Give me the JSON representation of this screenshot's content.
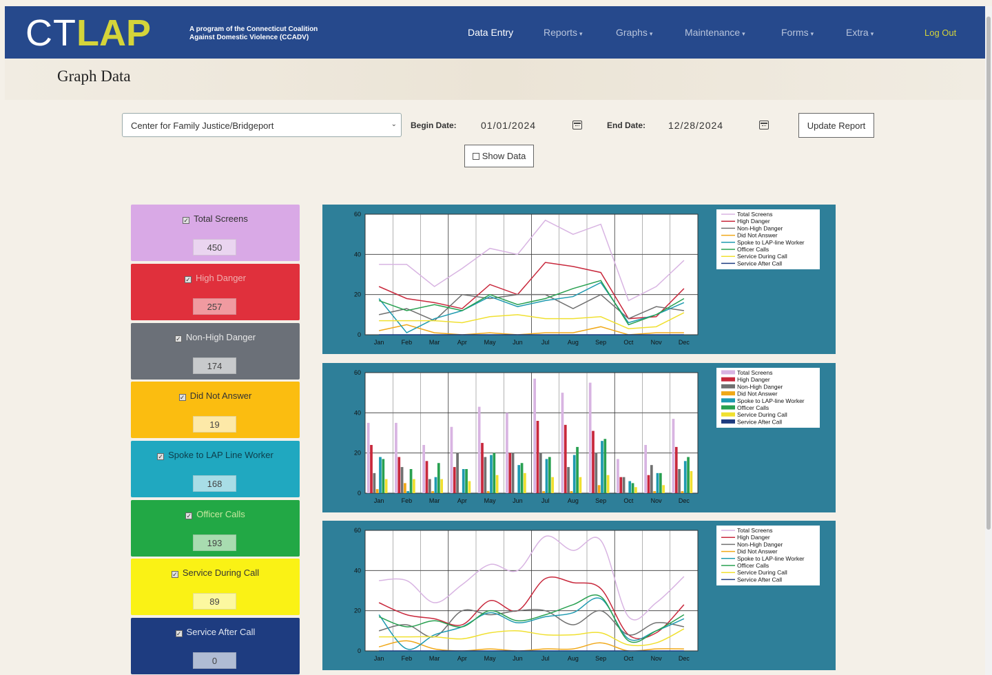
{
  "brand": {
    "ct": "CT",
    "lap": "LAP",
    "tagline_1": "A program of the Connecticut Coalition",
    "tagline_2": "Against Domestic Violence (CCADV)"
  },
  "nav": {
    "items": [
      {
        "label": "Data Entry",
        "dropdown": false,
        "active": true
      },
      {
        "label": "Reports",
        "dropdown": true
      },
      {
        "label": "Graphs",
        "dropdown": true
      },
      {
        "label": "Maintenance",
        "dropdown": true
      },
      {
        "label": "Forms",
        "dropdown": true
      },
      {
        "label": "Extra",
        "dropdown": true
      }
    ],
    "logout": "Log Out"
  },
  "page": {
    "title": "Graph Data"
  },
  "filters": {
    "agency": "Center for Family Justice/Bridgeport",
    "begin_label": "Begin Date:",
    "begin_value": "01/01/2024",
    "end_label": "End Date:",
    "end_value": "12/28/2024",
    "update_label": "Update Report",
    "show_data_label": "Show Data",
    "show_data_checked": false
  },
  "cards": [
    {
      "label": "Total Screens",
      "value": "450",
      "checked": true,
      "bg": "#d9a9e6",
      "fg": "#333",
      "valbg": "#ead5f0"
    },
    {
      "label": "High Danger",
      "value": "257",
      "checked": true,
      "bg": "#e0303c",
      "fg": "#f0b0b0",
      "valbg": "#f09aa0"
    },
    {
      "label": "Non-High Danger",
      "value": "174",
      "checked": true,
      "bg": "#6b7078",
      "fg": "#e8e8e8",
      "valbg": "#c8cacc"
    },
    {
      "label": "Did Not Answer",
      "value": "19",
      "checked": true,
      "bg": "#fbbd10",
      "fg": "#333",
      "valbg": "#fde9a8"
    },
    {
      "label": "Spoke to LAP Line Worker",
      "value": "168",
      "checked": true,
      "bg": "#20a8c0",
      "fg": "#0d3d4a",
      "valbg": "#a8dde6"
    },
    {
      "label": "Officer Calls",
      "value": "193",
      "checked": true,
      "bg": "#22a845",
      "fg": "#c8e8a0",
      "valbg": "#a8dcb0"
    },
    {
      "label": "Service During Call",
      "value": "89",
      "checked": true,
      "bg": "#faf215",
      "fg": "#333",
      "valbg": "#fcf8a0"
    },
    {
      "label": "Service After Call",
      "value": "0",
      "checked": true,
      "bg": "#1e3c80",
      "fg": "#e0e6f0",
      "valbg": "#b0bcd4"
    }
  ],
  "chart_data": [
    {
      "type": "line",
      "categories": [
        "Jan",
        "Feb",
        "Mar",
        "Apr",
        "May",
        "Jun",
        "Jul",
        "Aug",
        "Sep",
        "Oct",
        "Nov",
        "Dec"
      ],
      "ylim": [
        0,
        60
      ],
      "yticks": [
        0,
        20,
        40,
        60
      ],
      "grid": true,
      "legend": "top-right",
      "series": [
        {
          "name": "Total Screens",
          "color": "#d8b4e2",
          "values": [
            35,
            35,
            24,
            33,
            43,
            40,
            57,
            50,
            55,
            17,
            24,
            37
          ]
        },
        {
          "name": "High Danger",
          "color": "#c8283c",
          "values": [
            24,
            18,
            16,
            13,
            25,
            20,
            36,
            34,
            31,
            8,
            9,
            23
          ]
        },
        {
          "name": "Non-High Danger",
          "color": "#707070",
          "values": [
            10,
            13,
            7,
            20,
            18,
            20,
            20,
            13,
            20,
            8,
            14,
            12
          ]
        },
        {
          "name": "Did Not Answer",
          "color": "#f0a818",
          "values": [
            2,
            5,
            1,
            0,
            1,
            0,
            1,
            1,
            4,
            0,
            1,
            1
          ]
        },
        {
          "name": "Spoke to LAP-line Worker",
          "color": "#1e9ab0",
          "values": [
            18,
            1,
            8,
            12,
            19,
            14,
            17,
            19,
            26,
            6,
            10,
            16
          ]
        },
        {
          "name": "Officer Calls",
          "color": "#28a050",
          "values": [
            17,
            12,
            15,
            12,
            20,
            15,
            18,
            23,
            27,
            5,
            10,
            18
          ]
        },
        {
          "name": "Service During Call",
          "color": "#f0e030",
          "values": [
            7,
            7,
            7,
            6,
            9,
            10,
            8,
            8,
            9,
            3,
            4,
            11
          ]
        },
        {
          "name": "Service After Call",
          "color": "#1e3c80",
          "values": [
            0,
            0,
            0,
            0,
            0,
            0,
            0,
            0,
            0,
            0,
            0,
            0
          ]
        }
      ]
    },
    {
      "type": "bar",
      "categories": [
        "Jan",
        "Feb",
        "Mar",
        "Apr",
        "May",
        "Jun",
        "Jul",
        "Aug",
        "Sep",
        "Oct",
        "Nov",
        "Dec"
      ],
      "ylim": [
        0,
        60
      ],
      "yticks": [
        0,
        20,
        40,
        60
      ],
      "grid": true,
      "legend": "top-right",
      "series": [
        {
          "name": "Total Screens",
          "color": "#d8b4e2",
          "values": [
            35,
            35,
            24,
            33,
            43,
            40,
            57,
            50,
            55,
            17,
            24,
            37
          ]
        },
        {
          "name": "High Danger",
          "color": "#c8283c",
          "values": [
            24,
            18,
            16,
            13,
            25,
            20,
            36,
            34,
            31,
            8,
            9,
            23
          ]
        },
        {
          "name": "Non-High Danger",
          "color": "#707070",
          "values": [
            10,
            13,
            7,
            20,
            18,
            20,
            20,
            13,
            20,
            8,
            14,
            12
          ]
        },
        {
          "name": "Did Not Answer",
          "color": "#f0a818",
          "values": [
            2,
            5,
            1,
            0,
            1,
            0,
            1,
            1,
            4,
            0,
            1,
            1
          ]
        },
        {
          "name": "Spoke to LAP-line Worker",
          "color": "#1e9ab0",
          "values": [
            18,
            1,
            8,
            12,
            19,
            14,
            17,
            19,
            26,
            6,
            10,
            16
          ]
        },
        {
          "name": "Officer Calls",
          "color": "#28a050",
          "values": [
            17,
            12,
            15,
            12,
            20,
            15,
            18,
            23,
            27,
            5,
            10,
            18
          ]
        },
        {
          "name": "Service During Call",
          "color": "#f0e030",
          "values": [
            7,
            7,
            7,
            6,
            9,
            10,
            8,
            8,
            9,
            3,
            4,
            11
          ]
        },
        {
          "name": "Service After Call",
          "color": "#1e3c80",
          "values": [
            0,
            0,
            0,
            0,
            0,
            0,
            0,
            0,
            0,
            0,
            0,
            0
          ]
        }
      ]
    },
    {
      "type": "line",
      "smooth": true,
      "categories": [
        "Jan",
        "Feb",
        "Mar",
        "Apr",
        "May",
        "Jun",
        "Jul",
        "Aug",
        "Sep",
        "Oct",
        "Nov",
        "Dec"
      ],
      "ylim": [
        0,
        60
      ],
      "yticks": [
        0,
        20,
        40,
        60
      ],
      "grid": true,
      "legend": "top-right",
      "series": [
        {
          "name": "Total Screens",
          "color": "#d8b4e2",
          "values": [
            35,
            35,
            24,
            33,
            43,
            40,
            57,
            50,
            55,
            17,
            24,
            37
          ]
        },
        {
          "name": "High Danger",
          "color": "#c8283c",
          "values": [
            24,
            18,
            16,
            13,
            25,
            20,
            36,
            34,
            31,
            8,
            9,
            23
          ]
        },
        {
          "name": "Non-High Danger",
          "color": "#707070",
          "values": [
            10,
            13,
            7,
            20,
            18,
            20,
            20,
            13,
            20,
            8,
            14,
            12
          ]
        },
        {
          "name": "Did Not Answer",
          "color": "#f0a818",
          "values": [
            2,
            5,
            1,
            0,
            1,
            0,
            1,
            1,
            4,
            0,
            1,
            1
          ]
        },
        {
          "name": "Spoke to LAP-line Worker",
          "color": "#1e9ab0",
          "values": [
            18,
            1,
            8,
            12,
            19,
            14,
            17,
            19,
            26,
            6,
            10,
            16
          ]
        },
        {
          "name": "Officer Calls",
          "color": "#28a050",
          "values": [
            17,
            12,
            15,
            12,
            20,
            15,
            18,
            23,
            27,
            5,
            10,
            18
          ]
        },
        {
          "name": "Service During Call",
          "color": "#f0e030",
          "values": [
            7,
            7,
            7,
            6,
            9,
            10,
            8,
            8,
            9,
            3,
            4,
            11
          ]
        },
        {
          "name": "Service After Call",
          "color": "#1e3c80",
          "values": [
            0,
            0,
            0,
            0,
            0,
            0,
            0,
            0,
            0,
            0,
            0,
            0
          ]
        }
      ]
    }
  ]
}
